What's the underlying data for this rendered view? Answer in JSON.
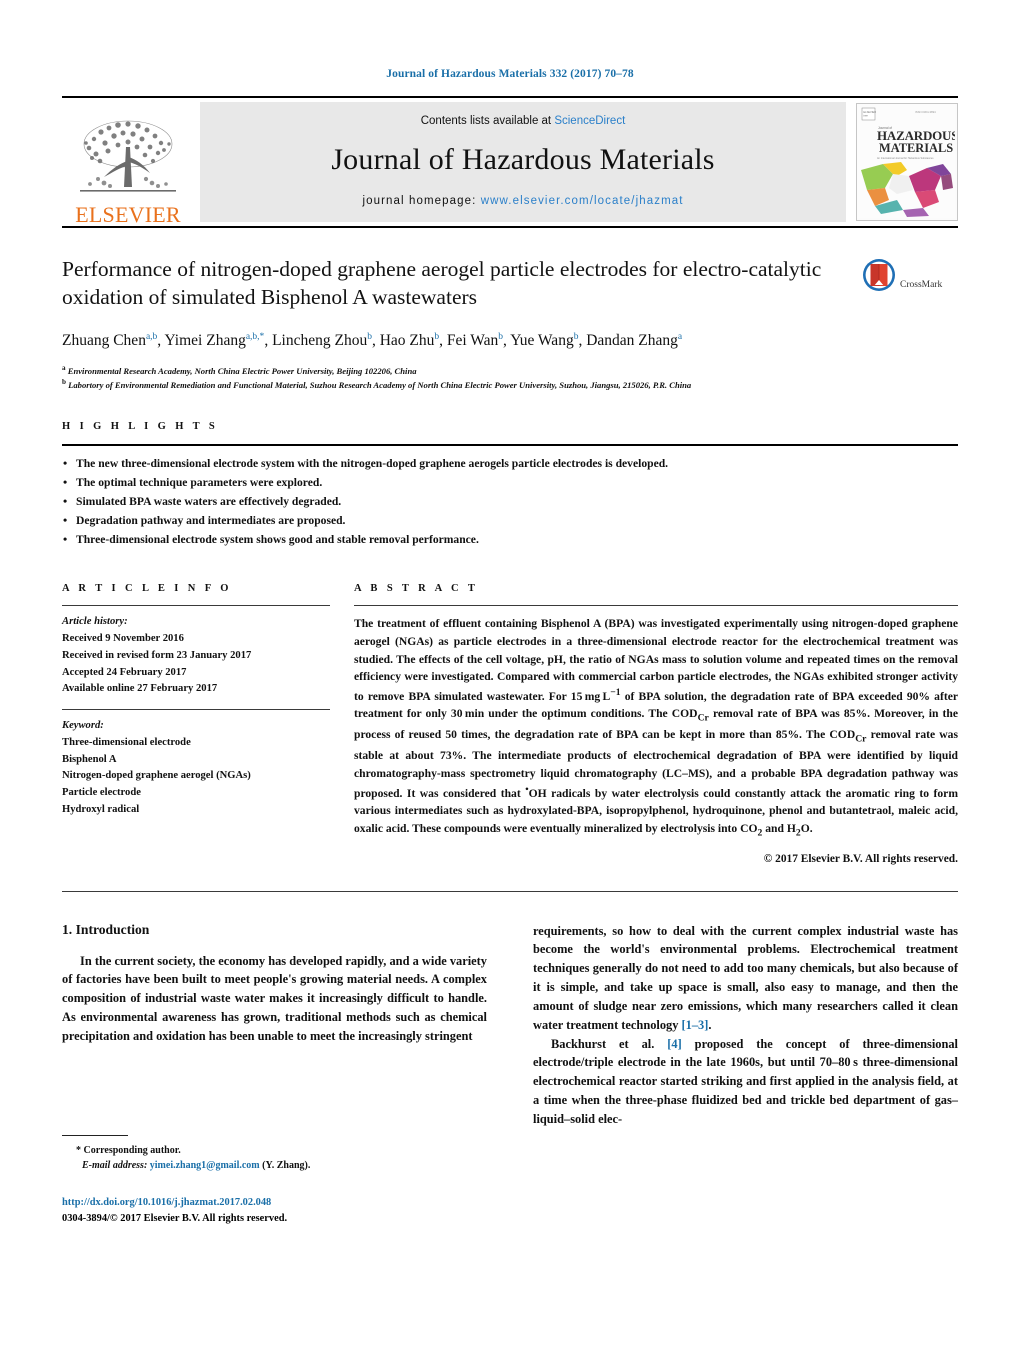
{
  "running_head": "Journal of Hazardous Materials 332 (2017) 70–78",
  "masthead": {
    "publisher": "ELSEVIER",
    "contents_prefix": "Contents lists available at ",
    "contents_link": "ScienceDirect",
    "journal_name": "Journal of Hazardous Materials",
    "homepage_prefix": "journal homepage: ",
    "homepage_url": "www.elsevier.com/locate/jhazmat",
    "cover_title_top": "HAZARDOUS",
    "cover_title_bottom": "MATERIALS",
    "link_color": "#2a7fc9",
    "elsevier_orange": "#E9711C"
  },
  "article": {
    "title": "Performance of nitrogen-doped graphene aerogel particle electrodes for electro-catalytic oxidation of simulated Bisphenol A wastewaters",
    "crossmark_label": "CrossMark",
    "authors_html": "Zhuang Chen<sup>a,b</sup>, Yimei Zhang<sup>a,b,*</sup>, Lincheng Zhou<sup>b</sup>, Hao Zhu<sup>b</sup>, Fei Wan<sup>b</sup>, Yue Wang<sup>b</sup>, Dandan Zhang<sup>a</sup>",
    "affiliation_a": "Environmental Research Academy, North China Electric Power University, Beijing 102206, China",
    "affiliation_b": "Labortory of Environmental Remediation and Functional Material, Suzhou Research Academy of North China Electric Power University, Suzhou, Jiangsu, 215026, P.R. China"
  },
  "highlights": {
    "heading": "H I G H L I G H T S",
    "items": [
      "The new three-dimensional electrode system with the nitrogen-doped graphene aerogels particle electrodes is developed.",
      "The optimal technique parameters were explored.",
      "Simulated BPA waste waters are effectively degraded.",
      "Degradation pathway and intermediates are proposed.",
      "Three-dimensional electrode system shows good and stable removal performance."
    ]
  },
  "article_info": {
    "heading": "A R T I C L E    I N F O",
    "history_label": "Article history:",
    "history": [
      "Received 9 November 2016",
      "Received in revised form 23 January 2017",
      "Accepted 24 February 2017",
      "Available online 27 February 2017"
    ],
    "keyword_label": "Keyword:",
    "keywords": [
      "Three-dimensional electrode",
      "Bisphenol A",
      "Nitrogen-doped graphene aerogel (NGAs)",
      "Particle electrode",
      "Hydroxyl radical"
    ]
  },
  "abstract": {
    "heading": "A B S T R A C T",
    "text_html": "The treatment of effluent containing Bisphenol A (BPA) was investigated experimentally using nitrogen-doped graphene aerogel (NGAs) as particle electrodes in a three-dimensional electrode reactor for the electrochemical treatment was studied. The effects of the cell voltage, pH, the ratio of NGAs mass to solution volume and repeated times on the removal efficiency were investigated. Compared with commercial carbon particle electrodes, the NGAs exhibited stronger activity to remove BPA simulated wastewater. For 15&#8239;mg&#8239;L<sup>&#8722;1</sup> of BPA solution, the degradation rate of BPA exceeded 90% after treatment for only 30&#8239;min under the optimum conditions. The COD<sub>Cr</sub> removal rate of BPA was 85%. Moreover, in the process of reused 50 times, the degradation rate of BPA can be kept in more than 85%. The COD<sub>Cr</sub> removal rate was stable at about 73%. The intermediate products of electrochemical degradation of BPA were identified by liquid chromatography-mass spectrometry liquid chromatography (LC&#8211;MS), and a probable BPA degradation pathway was proposed. It was considered that <sup>&#8226;</sup>OH radicals by water electrolysis could constantly attack the aromatic ring to form various intermediates such as hydroxylated-BPA, isopropylphenol, hydroquinone, phenol and butantetraol, maleic acid, oxalic acid. These compounds were eventually mineralized by electrolysis into CO<sub>2</sub> and H<sub>2</sub>O.",
    "copyright": "© 2017 Elsevier B.V. All rights reserved."
  },
  "body": {
    "section_number_title": "1.  Introduction",
    "left_para_1": "In the current society, the economy has developed rapidly, and a wide variety of factories have been built to meet people's growing material needs. A complex composition of industrial waste water makes it increasingly difficult to handle. As environmental awareness has grown, traditional methods such as chemical precipitation and oxidation has been unable to meet the increasingly stringent",
    "right_para_1_html": "requirements, so how to deal with the current complex industrial waste has become the world's environmental problems. Electrochemical treatment techniques generally do not need to add too many chemicals, but also because of it is simple, and take up space is small, also easy to manage, and then the amount of sludge near zero emissions, which many researchers called it clean water treatment technology <span class=\"ref\">[1&#8211;3]</span>.",
    "right_para_2_html": "Backhurst et al. <span class=\"ref\">[4]</span> proposed the concept of three-dimensional electrode/triple electrode in the late 1960s, but until 70&#8211;80&#8239;s three-dimensional electrochemical reactor started striking and first applied in the analysis field, at a time when the three-phase fluidized bed and trickle bed department of gas&#8211;liquid&#8211;solid elec-"
  },
  "footer": {
    "corresponding_marker": "*",
    "corresponding_label": "Corresponding author.",
    "email_label": "E-mail address:",
    "email": "yimei.zhang1@gmail.com",
    "email_suffix": "(Y. Zhang).",
    "doi": "http://dx.doi.org/10.1016/j.jhazmat.2017.02.048",
    "issn_line": "0304-3894/© 2017 Elsevier B.V. All rights reserved."
  }
}
